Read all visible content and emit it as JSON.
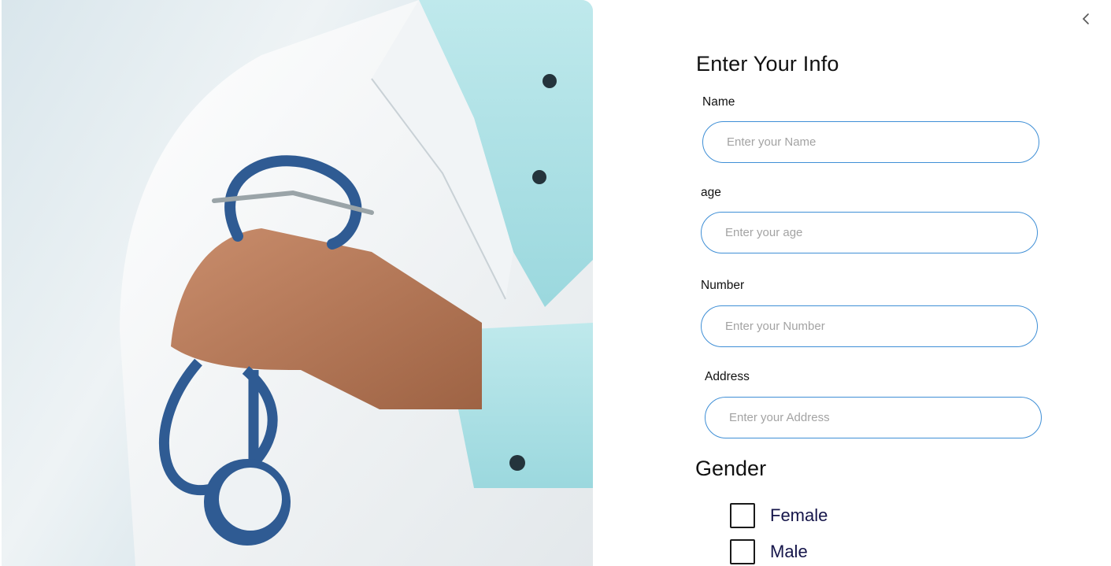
{
  "hero": {
    "description_icon": "doctor-with-stethoscope-photo"
  },
  "nav": {
    "back_icon": "chevron-left-icon"
  },
  "form": {
    "title": "Enter Your Info",
    "fields": [
      {
        "label": "Name",
        "placeholder": "Enter your Name",
        "value": ""
      },
      {
        "label": "age",
        "placeholder": "Enter your age",
        "value": ""
      },
      {
        "label": "Number",
        "placeholder": "Enter your Number",
        "value": ""
      },
      {
        "label": "Address",
        "placeholder": "Enter your Address",
        "value": ""
      }
    ]
  },
  "gender": {
    "title": "Gender",
    "options": [
      {
        "label": "Female",
        "checked": false
      },
      {
        "label": "Male",
        "checked": false
      }
    ]
  },
  "colors": {
    "input_border": "#3f8fd6",
    "text": "#111111",
    "placeholder": "#a3a3a3",
    "option_text": "#15154a"
  }
}
